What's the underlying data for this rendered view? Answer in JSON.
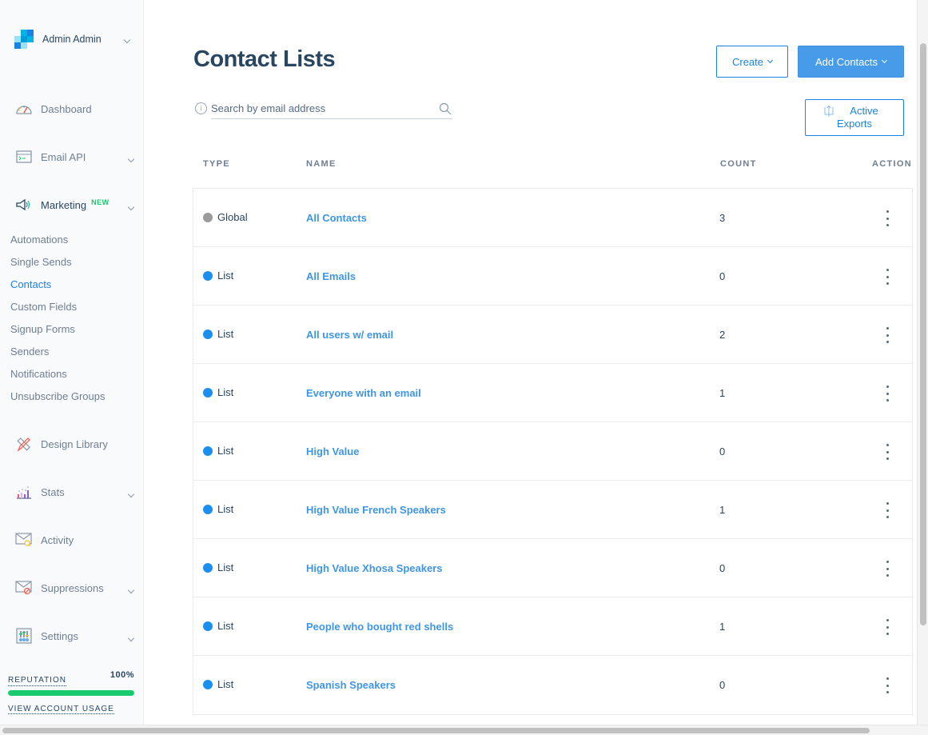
{
  "account": {
    "name": "Admin Admin"
  },
  "sidebar": {
    "items": [
      {
        "label": "Dashboard",
        "icon": "dashboard-gauge-icon",
        "has_chevron": false
      },
      {
        "label": "Email API",
        "icon": "terminal-window-icon",
        "has_chevron": true
      },
      {
        "label": "Marketing",
        "icon": "megaphone-icon",
        "has_chevron": true,
        "badge": "NEW"
      },
      {
        "label": "Design Library",
        "icon": "pencil-ruler-icon",
        "has_chevron": false
      },
      {
        "label": "Stats",
        "icon": "bar-chart-icon",
        "has_chevron": true
      },
      {
        "label": "Activity",
        "icon": "envelope-search-icon",
        "has_chevron": false
      },
      {
        "label": "Suppressions",
        "icon": "envelope-blocked-icon",
        "has_chevron": true
      },
      {
        "label": "Settings",
        "icon": "sliders-icon",
        "has_chevron": true
      }
    ],
    "marketing_subitems": [
      {
        "label": "Automations",
        "current": false
      },
      {
        "label": "Single Sends",
        "current": false
      },
      {
        "label": "Contacts",
        "current": true
      },
      {
        "label": "Custom Fields",
        "current": false
      },
      {
        "label": "Signup Forms",
        "current": false
      },
      {
        "label": "Senders",
        "current": false
      },
      {
        "label": "Notifications",
        "current": false
      },
      {
        "label": "Unsubscribe Groups",
        "current": false
      }
    ],
    "reputation": {
      "label": "REPUTATION",
      "value": "100%",
      "percent": 100
    },
    "usage_link": "VIEW ACCOUNT USAGE"
  },
  "page": {
    "title": "Contact Lists",
    "search_placeholder": "Search by email address",
    "buttons": {
      "create": "Create",
      "add_contacts": "Add Contacts",
      "active_exports_line1": "Active",
      "active_exports_line2": "Exports"
    }
  },
  "table": {
    "headers": {
      "type": "TYPE",
      "name": "NAME",
      "count": "COUNT",
      "action": "ACTION"
    },
    "rows": [
      {
        "type": "Global",
        "name": "All Contacts",
        "count": "3"
      },
      {
        "type": "List",
        "name": "All Emails",
        "count": "0"
      },
      {
        "type": "List",
        "name": "All users w/ email",
        "count": "2"
      },
      {
        "type": "List",
        "name": "Everyone with an email",
        "count": "1"
      },
      {
        "type": "List",
        "name": "High Value",
        "count": "0"
      },
      {
        "type": "List",
        "name": "High Value French Speakers",
        "count": "1"
      },
      {
        "type": "List",
        "name": "High Value Xhosa Speakers",
        "count": "0"
      },
      {
        "type": "List",
        "name": "People who bought red shells",
        "count": "1"
      },
      {
        "type": "List",
        "name": "Spanish Speakers",
        "count": "0"
      }
    ]
  },
  "colors": {
    "accent": "#1a82e2",
    "global_dot": "#9b9b9b",
    "list_dot": "#1a8ff0",
    "reputation_bar": "#18c96e",
    "new_badge": "#18c96e"
  }
}
